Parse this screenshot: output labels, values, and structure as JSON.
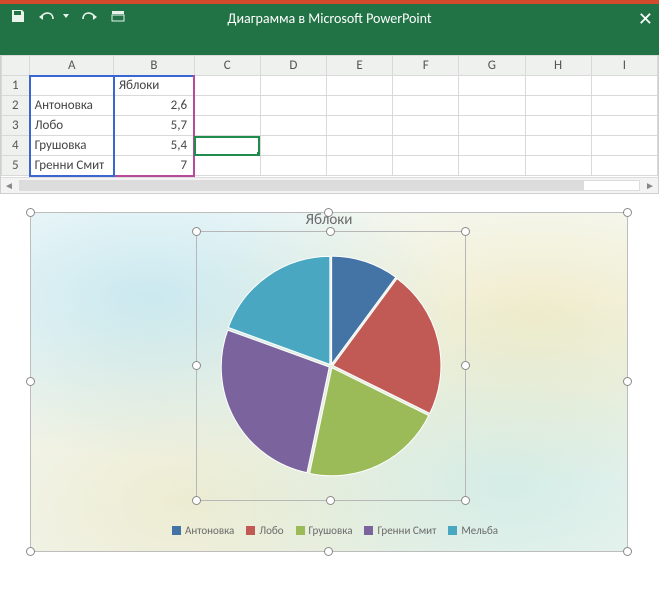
{
  "titlebar": {
    "title": "Диаграмма в Microsoft PowerPoint",
    "close_glyph": "✕"
  },
  "sheet": {
    "columns": [
      "A",
      "B",
      "C",
      "D",
      "E",
      "F",
      "G",
      "H",
      "I"
    ],
    "rows": [
      {
        "n": "1",
        "a": "",
        "b": "Яблоки"
      },
      {
        "n": "2",
        "a": "Антоновка",
        "b": "2,6"
      },
      {
        "n": "3",
        "a": "Лобо",
        "b": "5,7"
      },
      {
        "n": "4",
        "a": "Грушовка",
        "b": "5,4"
      },
      {
        "n": "5",
        "a": "Гренни Смит",
        "b": "7"
      }
    ],
    "active_cell": "C4"
  },
  "chart": {
    "title": "Яблоки",
    "legend": [
      {
        "label": "Антоновка",
        "color": "#4473a6"
      },
      {
        "label": "Лобо",
        "color": "#c15a54"
      },
      {
        "label": "Грушовка",
        "color": "#9bbb59"
      },
      {
        "label": "Гренни Смит",
        "color": "#7b639e"
      },
      {
        "label": "Мельба",
        "color": "#49a7c2"
      }
    ]
  },
  "chart_data": {
    "type": "pie",
    "title": "Яблоки",
    "series": [
      {
        "name": "Антоновка",
        "value": 2.6,
        "color": "#4473a6"
      },
      {
        "name": "Лобо",
        "value": 5.7,
        "color": "#c15a54"
      },
      {
        "name": "Грушовка",
        "value": 5.4,
        "color": "#9bbb59"
      },
      {
        "name": "Гренни Смит",
        "value": 7.0,
        "color": "#7b639e"
      },
      {
        "name": "Мельба",
        "value": 5.0,
        "color": "#49a7c2"
      }
    ]
  }
}
